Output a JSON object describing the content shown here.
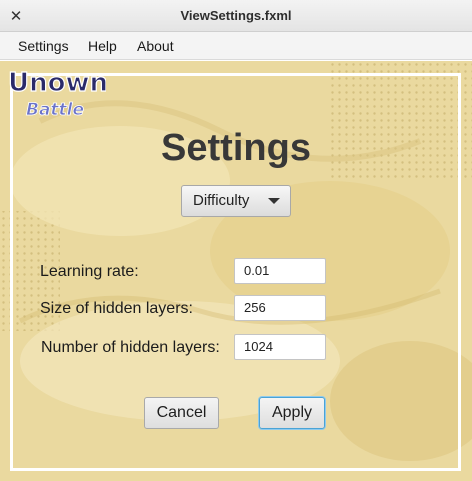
{
  "window": {
    "title": "ViewSettings.fxml",
    "close_glyph": "✕"
  },
  "menu": {
    "items": [
      "Settings",
      "Help",
      "About"
    ]
  },
  "logo": {
    "line1": "Unown",
    "line2": "Battle"
  },
  "form": {
    "heading": "Settings",
    "difficulty": {
      "label": "Difficulty",
      "icon": "dropdown-arrow-icon"
    },
    "fields": [
      {
        "label": "Learning rate:",
        "value": "0.01"
      },
      {
        "label": "Size of hidden layers:",
        "value": "256"
      },
      {
        "label": "Number of hidden layers:",
        "value": "1024"
      }
    ],
    "cancel_label": "Cancel",
    "apply_label": "Apply"
  },
  "colors": {
    "background": "#e9d99e",
    "frame": "#ffffff",
    "heading": "#383838",
    "focus_ring": "#4aa3d6"
  }
}
